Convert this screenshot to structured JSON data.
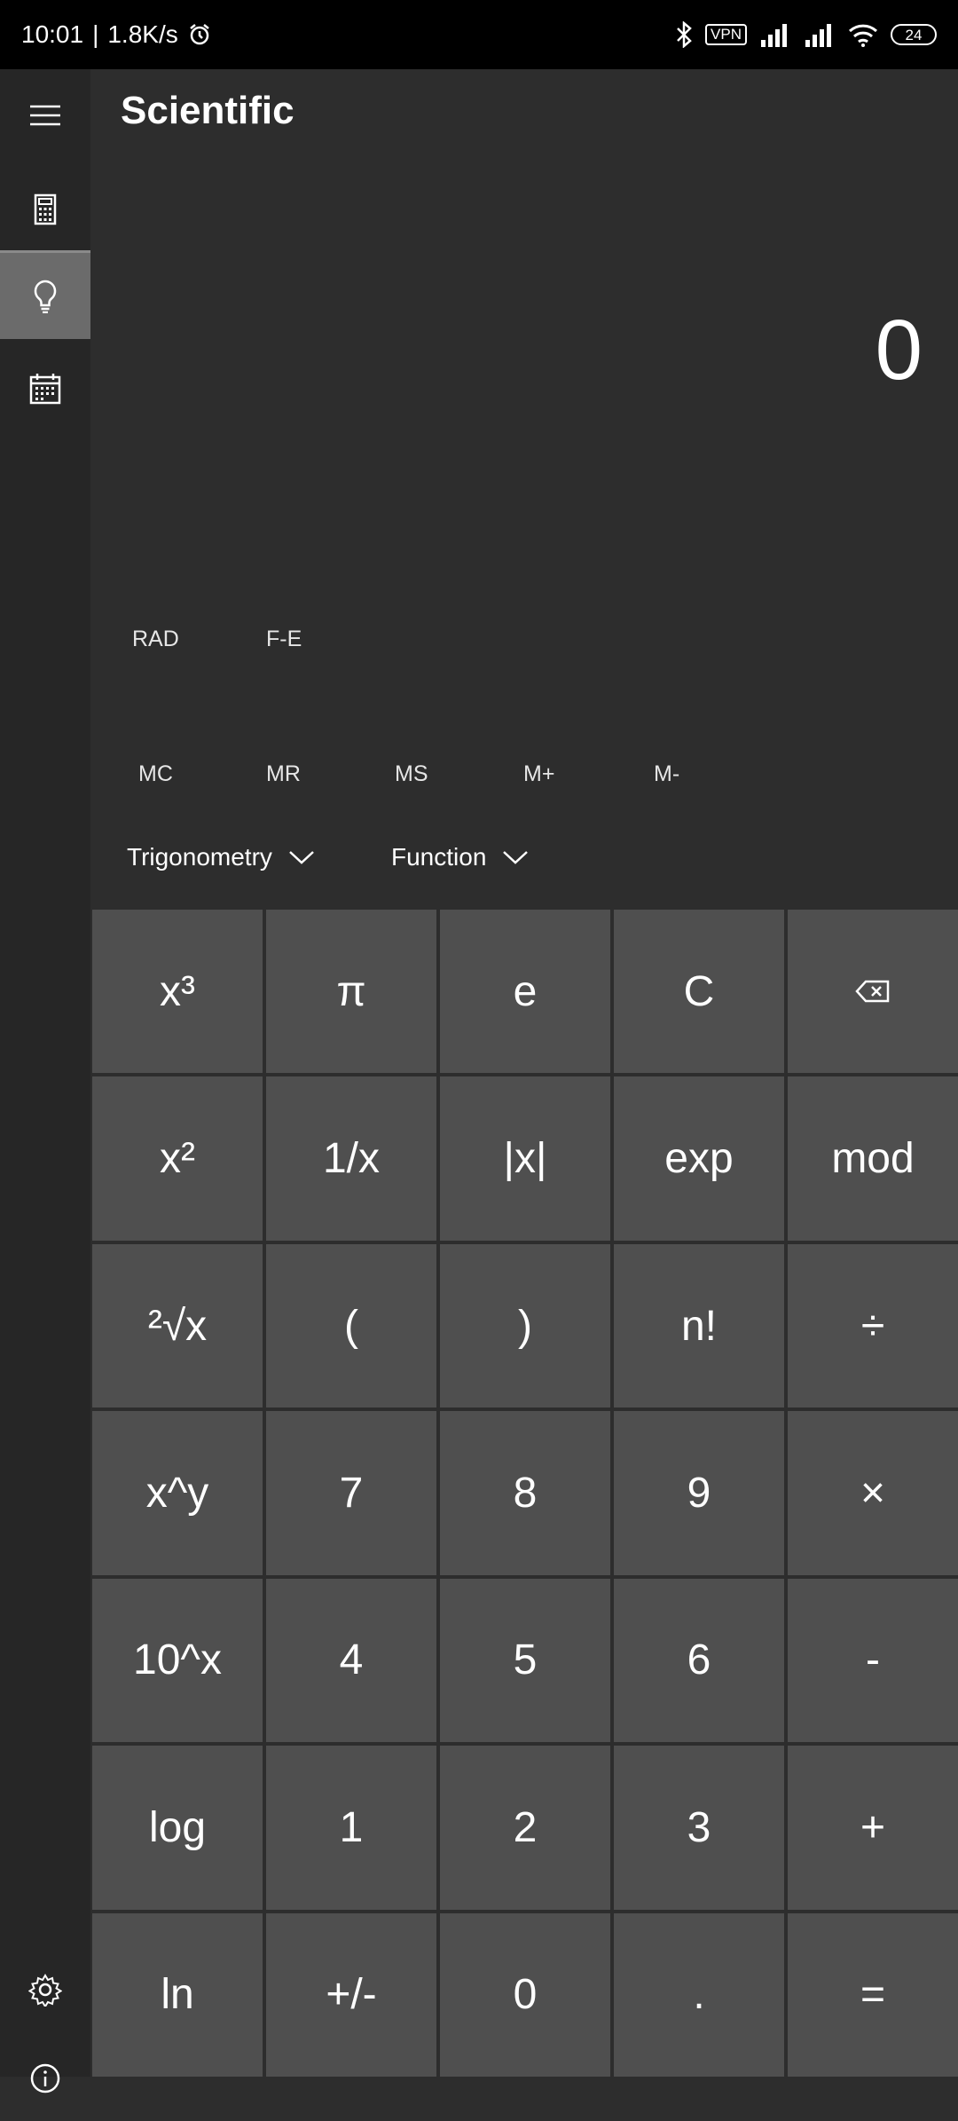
{
  "status": {
    "time": "10:01",
    "separator": "|",
    "speed": "1.8K/s",
    "vpn": "VPN",
    "battery": "24"
  },
  "app": {
    "title": "Scientific"
  },
  "display": {
    "value": "0"
  },
  "modes": {
    "angle": "RAD",
    "format": "F-E"
  },
  "memory": [
    "MC",
    "MR",
    "MS",
    "M+",
    "M-"
  ],
  "dropdowns": {
    "trig": "Trigonometry",
    "function": "Function"
  },
  "keys": {
    "r1": [
      "x³",
      "π",
      "e",
      "C",
      "⌫"
    ],
    "r2": [
      "x²",
      "1/x",
      "|x|",
      "exp",
      "mod"
    ],
    "r3": [
      "²√x",
      "(",
      ")",
      "n!",
      "÷"
    ],
    "r4": [
      "x^y",
      "7",
      "8",
      "9",
      "×"
    ],
    "r5": [
      "10^x",
      "4",
      "5",
      "6",
      "-"
    ],
    "r6": [
      "log",
      "1",
      "2",
      "3",
      "+"
    ],
    "r7": [
      "ln",
      "+/-",
      "0",
      ".",
      "="
    ]
  },
  "colors": {
    "background": "#2d2d2d",
    "sidebar": "#262626",
    "key": "#4f4f4f",
    "active_nav": "#6b6b6b"
  }
}
